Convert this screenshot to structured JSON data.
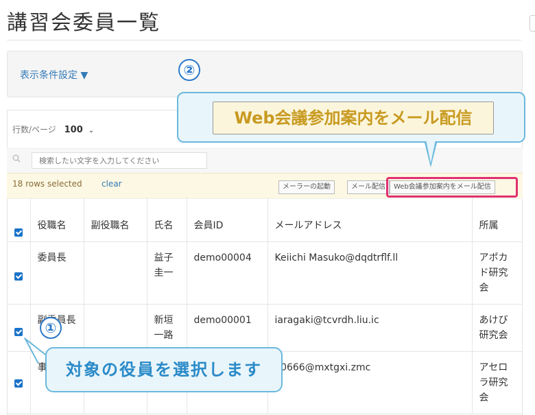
{
  "page": {
    "title": "講習会委員一覧"
  },
  "filter": {
    "toggle_label": "表示条件設定 ▼"
  },
  "table_controls": {
    "rows_per_page_label": "行数/ページ",
    "rows_per_page_value": "100",
    "search_placeholder": "検索したい文字を入力してください"
  },
  "selection": {
    "selected_text": "18 rows selected",
    "clear_label": "clear"
  },
  "actions": {
    "mailer_label": "メーラーの起動",
    "mail_label": "メール配信",
    "web_label": "Web会議参加案内をメール配信"
  },
  "table": {
    "headers": [
      "役職名",
      "副役職名",
      "氏名",
      "会員ID",
      "メールアドレス",
      "所属"
    ],
    "rows": [
      {
        "title": "委員長",
        "sub_title": "",
        "name": "益子圭一",
        "member_id": "demo00004",
        "email": "Keiichi Masuko@dqdtrflf.ll",
        "affiliation": "アポカド研究会"
      },
      {
        "title": "副委員長",
        "sub_title": "",
        "name": "新垣一路",
        "member_id": "demo00001",
        "email": "iaragaki@tcvrdh.liu.ic",
        "affiliation": "あけび研究会"
      },
      {
        "title": "事",
        "sub_title": "",
        "name": "",
        "member_id": "",
        "email": "a0666@mxtgxi.zmc",
        "affiliation": "アセロラ研究会"
      }
    ]
  },
  "annotations": {
    "num1": "①",
    "num2": "②",
    "callout_top_text": "Web会議参加案内をメール配信",
    "callout_bottom_text": "対象の役員を選択します"
  },
  "colors": {
    "accent_blue": "#1a73c8",
    "callout_border": "#6ab8dc",
    "highlight_pink": "#e03070",
    "selected_bar_bg": "#fcf8e3"
  }
}
